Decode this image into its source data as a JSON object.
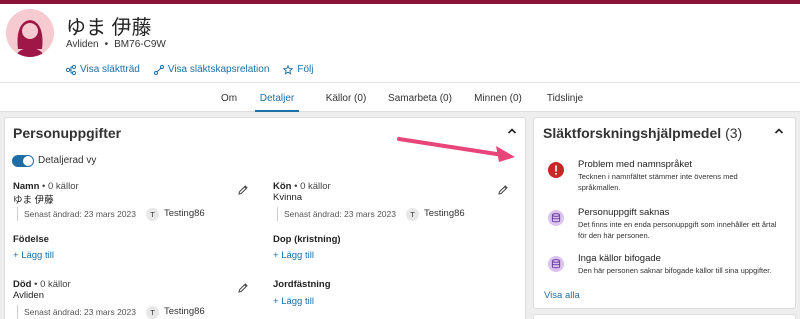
{
  "person": {
    "name": "ゆま 伊藤",
    "status": "Avliden",
    "id": "BM76-C9W"
  },
  "header_links": {
    "tree": "Visa släktträd",
    "relation": "Visa släktskapsrelation",
    "follow": "Följ"
  },
  "tabs": [
    "Om",
    "Detaljer",
    "Källor (0)",
    "Samarbeta (0)",
    "Minnen (0)",
    "Tidslinje"
  ],
  "active_tab": "Detaljer",
  "left_card": {
    "title": "Personuppgifter",
    "toggle_label": "Detaljerad vy",
    "name_label": "Namn",
    "name_sources": "• 0 källor",
    "name_value": "ゆま 伊藤",
    "name_meta": "Senast ändrad: 23 mars 2023",
    "name_user_initial": "T",
    "name_user": "Testing86",
    "gender_label": "Kön",
    "gender_sources": "• 0 källor",
    "gender_value": "Kvinna",
    "gender_meta": "Senast ändrad: 23 mars 2023",
    "gender_user_initial": "T",
    "gender_user": "Testing86",
    "birth_label": "Födelse",
    "birth_add": "Lägg till",
    "christening_label": "Dop (kristning)",
    "christening_add": "Lägg till",
    "death_label": "Död",
    "death_sources": "• 0 källor",
    "death_value": "Avliden",
    "death_meta": "Senast ändrad: 23 mars 2023",
    "death_user_initial": "T",
    "death_user": "Testing86",
    "burial_label": "Jordfästning",
    "burial_add": "Lägg till"
  },
  "right_card": {
    "title": "Släktforskningshjälpmedel",
    "count": "(3)",
    "items": [
      {
        "title": "Problem med namnspråket",
        "desc": "Tecknen i namnfältet stämmer inte överens med språkmallen.",
        "icon": "alert-icon",
        "color": "#c62828"
      },
      {
        "title": "Personuppgift saknas",
        "desc": "Det finns inte en enda personuppgift som innehåller ett årtal för den här personen.",
        "icon": "data-stack-icon",
        "color": "#c9a6e4"
      },
      {
        "title": "Inga källor bifogade",
        "desc": "Den här personen saknar bifogade källor till sina uppgifter.",
        "icon": "data-stack-icon",
        "color": "#c9a6e4"
      }
    ],
    "show_all": "Visa alla"
  },
  "colors": {
    "brand_bar": "#8a1538",
    "link": "#1e6ea5",
    "annotation_arrow": "#e8457a"
  }
}
